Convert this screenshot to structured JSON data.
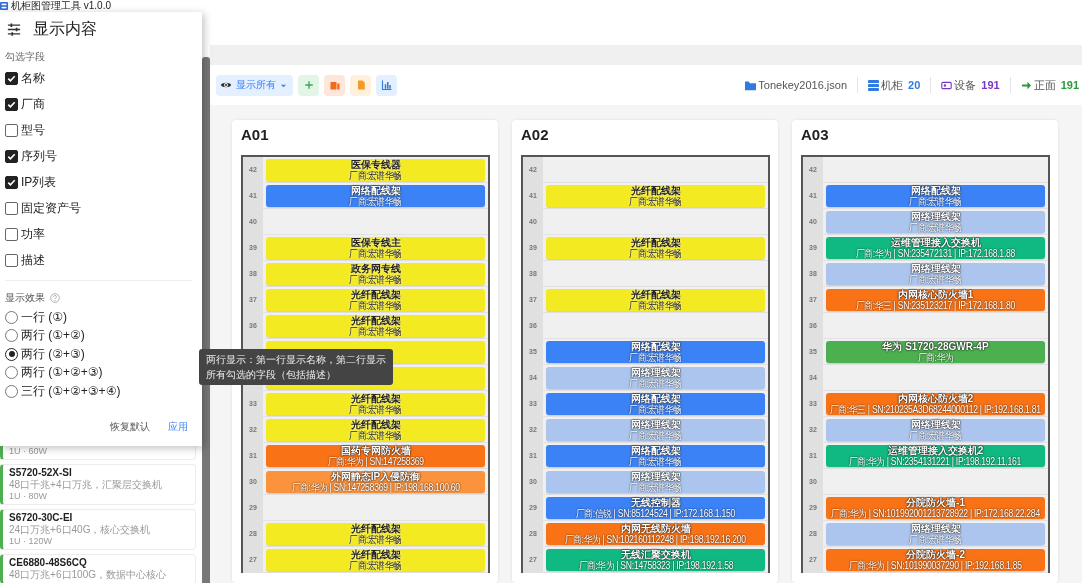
{
  "window": {
    "title": "机柜图管理工具 v1.0.0"
  },
  "sidebar": {
    "cards": [
      {
        "spec": "1U · 60W"
      },
      {
        "title": "S5720-52X-SI",
        "desc": "48口千兆+4口万兆，汇聚层交换机",
        "spec": "1U · 80W"
      },
      {
        "title": "S6720-30C-EI",
        "desc": "24口万兆+6口40G，核心交换机",
        "spec": "1U · 120W"
      },
      {
        "title": "CE6880-48S6CQ",
        "desc": "48口万兆+6口100G，数据中心核心"
      }
    ]
  },
  "toolbar": {
    "buttons": [
      {
        "kind": "view",
        "label": "显示所有"
      },
      {
        "kind": "add"
      },
      {
        "kind": "stack"
      },
      {
        "kind": "file"
      },
      {
        "kind": "chart"
      }
    ],
    "stats": [
      {
        "kind": "file",
        "label": "Tonekey2016.json"
      },
      {
        "kind": "racks",
        "label": "机柜",
        "value": "20"
      },
      {
        "kind": "devices",
        "label": "设备",
        "value": "191"
      },
      {
        "kind": "front",
        "label": "正面",
        "value": "191"
      }
    ]
  },
  "racks": [
    {
      "name": "A01",
      "units": [
        {
          "u": "42",
          "device": {
            "name": "医保专线器",
            "detail": "厂商:宏谱华畅",
            "color": "#f4ea22"
          }
        },
        {
          "u": "41",
          "device": {
            "name": "网络配线架",
            "detail": "厂商:宏谱华畅",
            "color": "#3b82f6"
          }
        },
        {
          "u": "40"
        },
        {
          "u": "39",
          "device": {
            "name": "医保专线主",
            "detail": "厂商:宏谱华畅",
            "color": "#f4ea22"
          }
        },
        {
          "u": "38",
          "device": {
            "name": "政务网专线",
            "detail": "厂商:宏谱华畅",
            "color": "#f4ea22"
          }
        },
        {
          "u": "37",
          "device": {
            "name": "光纤配线架",
            "detail": "厂商:宏谱华畅",
            "color": "#f4ea22"
          }
        },
        {
          "u": "36",
          "device": {
            "name": "光纤配线架",
            "detail": "厂商:宏谱华畅",
            "color": "#f4ea22"
          }
        },
        {
          "device": {
            "color": "#f4ea22"
          }
        },
        {
          "device": {
            "color": "#f4ea22"
          }
        },
        {
          "u": "33",
          "device": {
            "name": "光纤配线架",
            "detail": "厂商:宏谱华畅",
            "color": "#f4ea22"
          }
        },
        {
          "u": "32",
          "device": {
            "name": "光纤配线架",
            "detail": "厂商:宏谱华畅",
            "color": "#f4ea22"
          }
        },
        {
          "u": "31",
          "device": {
            "name": "国药专网防火墙",
            "detail": "厂商:华为 | SN:147258369",
            "color": "#f97316"
          }
        },
        {
          "u": "30",
          "device": {
            "name": "外网静态IP入侵防御",
            "detail": "厂商:华为 | SN:147258369 | IP:198.168.100.60",
            "color": "#fb923c"
          }
        },
        {
          "u": "29"
        },
        {
          "u": "28",
          "device": {
            "name": "光纤配线架",
            "detail": "厂商:宏谱华畅",
            "color": "#f4ea22"
          }
        },
        {
          "u": "27",
          "device": {
            "name": "光纤配线架",
            "detail": "厂商:宏谱华畅",
            "color": "#f4ea22"
          }
        }
      ]
    },
    {
      "name": "A02",
      "units": [
        {
          "u": "42"
        },
        {
          "u": "41",
          "device": {
            "name": "光纤配线架",
            "detail": "厂商:宏谱华畅",
            "color": "#f4ea22"
          }
        },
        {
          "u": "40"
        },
        {
          "u": "39",
          "device": {
            "name": "光纤配线架",
            "detail": "厂商:宏谱华畅",
            "color": "#f4ea22"
          }
        },
        {
          "u": "38"
        },
        {
          "u": "37",
          "device": {
            "name": "光纤配线架",
            "detail": "厂商:宏谱华畅",
            "color": "#f4ea22"
          }
        },
        {
          "u": "36"
        },
        {
          "u": "35",
          "device": {
            "name": "网络配线架",
            "detail": "厂商:宏谱华畅",
            "color": "#3b82f6"
          }
        },
        {
          "u": "34",
          "device": {
            "name": "网络理线架",
            "detail": "厂商:宏谱华畅",
            "color": "#abc5ee"
          }
        },
        {
          "u": "33",
          "device": {
            "name": "网络配线架",
            "detail": "厂商:宏谱华畅",
            "color": "#3b82f6"
          }
        },
        {
          "u": "32",
          "device": {
            "name": "网络理线架",
            "detail": "厂商:宏谱华畅",
            "color": "#abc5ee"
          }
        },
        {
          "u": "31",
          "device": {
            "name": "网络配线架",
            "detail": "厂商:宏谱华畅",
            "color": "#3b82f6"
          }
        },
        {
          "u": "30",
          "device": {
            "name": "网络理线架",
            "detail": "厂商:宏谱华畅",
            "color": "#abc5ee"
          }
        },
        {
          "u": "29",
          "device": {
            "name": "无线控制器",
            "detail": "厂商:信锐 | SN:85124524 | IP:172.168.1.150",
            "color": "#3b82f6"
          }
        },
        {
          "u": "28",
          "device": {
            "name": "内网无线防火墙",
            "detail": "厂商:华为 | SN:102160112248 | IP:198.192.16.200",
            "color": "#f97316"
          }
        },
        {
          "u": "27",
          "device": {
            "name": "无线汇聚交换机",
            "detail": "厂商:华为 | SN:14758323 | IP:198.192.1.58",
            "color": "#10b981"
          }
        }
      ]
    },
    {
      "name": "A03",
      "units": [
        {
          "u": "42"
        },
        {
          "u": "41",
          "device": {
            "name": "网络配线架",
            "detail": "厂商:宏谱华畅",
            "color": "#3b82f6"
          }
        },
        {
          "u": "40",
          "device": {
            "name": "网络理线架",
            "detail": "厂商:宏谱华畅",
            "color": "#abc5ee"
          }
        },
        {
          "u": "39",
          "device": {
            "name": "运维管理接入交换机",
            "detail": "厂商:华为 | SN:235472131 | IP:172.168.1.88",
            "color": "#10b981"
          }
        },
        {
          "u": "38",
          "device": {
            "name": "网络理线架",
            "detail": "厂商:宏谱华畅",
            "color": "#abc5ee"
          }
        },
        {
          "u": "37",
          "device": {
            "name": "内网核心防火墙1",
            "detail": "厂商:华三 | SN:235123217 | IP:172.168.1.80",
            "color": "#f97316"
          }
        },
        {
          "u": "36"
        },
        {
          "u": "35",
          "device": {
            "name": "华为 S1720-28GWR-4P",
            "detail": "厂商:华为",
            "color": "#4caf50"
          }
        },
        {
          "u": "34"
        },
        {
          "u": "33",
          "device": {
            "name": "内网核心防火墙2",
            "detail": "厂商:华三 | SN:210235A3D68244000112 | IP:192.168.1.81",
            "color": "#f97316"
          }
        },
        {
          "u": "32",
          "device": {
            "name": "网络理线架",
            "detail": "厂商:宏谱华畅",
            "color": "#abc5ee"
          }
        },
        {
          "u": "31",
          "device": {
            "name": "运维管理接入交换机2",
            "detail": "厂商:华为 | SN:2354131221 | IP:198.192.11.161",
            "color": "#10b981"
          }
        },
        {
          "u": "30"
        },
        {
          "u": "29",
          "device": {
            "name": "分院防火墙-1",
            "detail": "厂商:华为 | SN:101992001213728922 | IP:172.168.22.284",
            "color": "#f97316"
          }
        },
        {
          "u": "28",
          "device": {
            "name": "网络理线架",
            "detail": "厂商:宏谱华畅",
            "color": "#abc5ee"
          }
        },
        {
          "u": "27",
          "device": {
            "name": "分院防火墙-2",
            "detail": "厂商:华为 | SN:101990037290 | IP:192.168.1.85",
            "color": "#f97316"
          }
        }
      ]
    }
  ],
  "popup": {
    "title": "显示内容",
    "fields_label": "勾选字段",
    "fields": [
      {
        "label": "名称",
        "checked": true
      },
      {
        "label": "厂商",
        "checked": true
      },
      {
        "label": "型号",
        "checked": false
      },
      {
        "label": "序列号",
        "checked": true
      },
      {
        "label": "IP列表",
        "checked": true
      },
      {
        "label": "固定资产号",
        "checked": false
      },
      {
        "label": "功率",
        "checked": false
      },
      {
        "label": "描述",
        "checked": false
      }
    ],
    "effect_label": "显示效果",
    "effects": [
      {
        "label": "一行 (①)",
        "selected": false
      },
      {
        "label": "两行 (①+②)",
        "selected": false
      },
      {
        "label": "两行 (②+③)",
        "selected": true
      },
      {
        "label": "两行 (①+②+③)",
        "selected": false
      },
      {
        "label": "三行 (①+②+③+④)",
        "selected": false
      }
    ],
    "buttons": [
      {
        "kind": "reset",
        "label": "恢复默认"
      },
      {
        "kind": "apply",
        "label": "应用"
      }
    ]
  },
  "tooltip": {
    "text": "两行显示：第一行显示名称，第二行显示所有勾选的字段（包括描述）"
  }
}
